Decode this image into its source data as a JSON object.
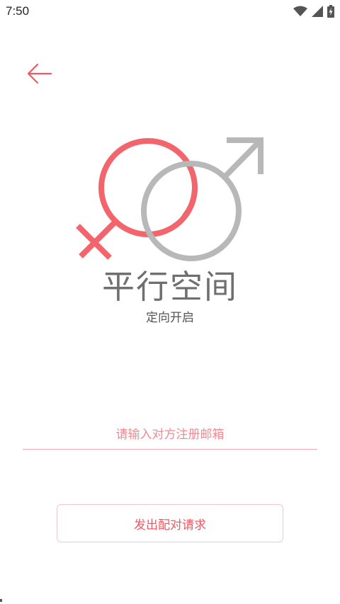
{
  "status_bar": {
    "time": "7:50",
    "icons": [
      "wifi-icon",
      "cellular-signal-icon",
      "battery-charging-icon"
    ]
  },
  "header": {
    "back_icon": "arrow-left-icon"
  },
  "logo": {
    "icon": "female-male-symbols-icon",
    "female_color": "#f2656c",
    "male_color": "#b8b8b8"
  },
  "app": {
    "title": "平行空间",
    "subtitle": "定向开启"
  },
  "form": {
    "email_placeholder": "请输入对方注册邮箱",
    "email_value": "",
    "submit_label": "发出配对请求"
  },
  "colors": {
    "accent": "#ec5a63",
    "underline": "#f3a9b0",
    "button_border": "#f6c6ca",
    "title_gray": "#6f6f6f"
  }
}
